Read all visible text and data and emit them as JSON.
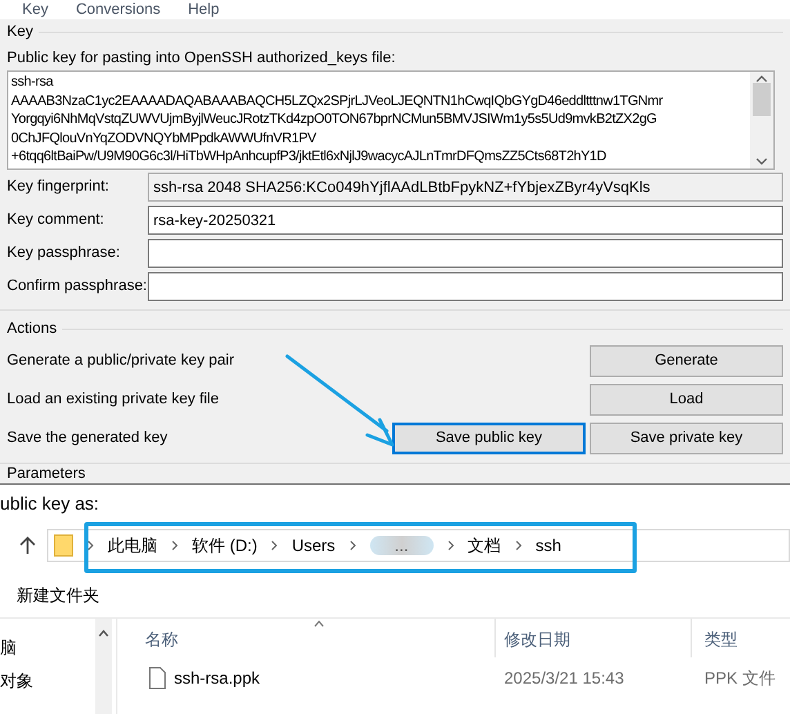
{
  "menu": [
    "Key",
    "Conversions",
    "Help"
  ],
  "key_group": {
    "title": "Key",
    "public_key_label": "Public key for pasting into OpenSSH authorized_keys file:",
    "public_key_lines": [
      "ssh-rsa",
      "AAAAB3NzaC1yc2EAAAADAQABAAABAQCH5LZQx2SPjrLJVeoLJEQNTN1hCwqIQbGYgD46eddltttnw1TGNmr",
      "Yorgqyi6NhMqVstqZUWVUjmByjlWeucJRotzTKd4zpO0TON67bprNCMun5BMVJSIWm1y5s5Ud9mvkB2tZX2gG",
      "0ChJFQlouVnYqZODVNQYbMPpdkAWWUfnVR1PV",
      "+6tqq6ltBaiPw/U9M90G6c3l/HiTbWHpAnhcupfP3/jktEtl6xNjlJ9wacycAJLnTmrDFQmsZZ5Cts68T2hY1D"
    ],
    "fields": [
      {
        "label": "Key fingerprint:",
        "value": "ssh-rsa 2048 SHA256:KCo049hYjflAAdLBtbFpykNZ+fYbjexZByr4yVsqKls",
        "readonly": true
      },
      {
        "label": "Key comment:",
        "value": "rsa-key-20250321",
        "readonly": false
      },
      {
        "label": "Key passphrase:",
        "readonly": false
      },
      {
        "label": "Confirm passphrase:",
        "readonly": false
      }
    ]
  },
  "actions": {
    "title": "Actions",
    "rows": [
      {
        "label": "Generate a public/private key pair",
        "buttons": [
          {
            "label": "Generate",
            "focused": false
          }
        ]
      },
      {
        "label": "Load an existing private key file",
        "buttons": [
          {
            "label": "Load",
            "focused": false
          }
        ]
      },
      {
        "label": "Save the generated key",
        "buttons": [
          {
            "label": "Save public key",
            "focused": true
          },
          {
            "label": "Save private key",
            "focused": false
          }
        ]
      }
    ]
  },
  "parameters_title": "Parameters",
  "save_dialog": {
    "title": "ublic key as:",
    "breadcrumb": [
      "此电脑",
      "软件 (D:)",
      "Users",
      "...",
      "文档",
      "ssh"
    ],
    "toolbar_button": "新建文件夹",
    "nav_items": [
      "脑",
      "对象"
    ],
    "columns": [
      "名称",
      "修改日期",
      "类型"
    ],
    "files": [
      {
        "name": "ssh-rsa.ppk",
        "modified": "2025/3/21 15:43",
        "type": "PPK 文件"
      }
    ]
  }
}
